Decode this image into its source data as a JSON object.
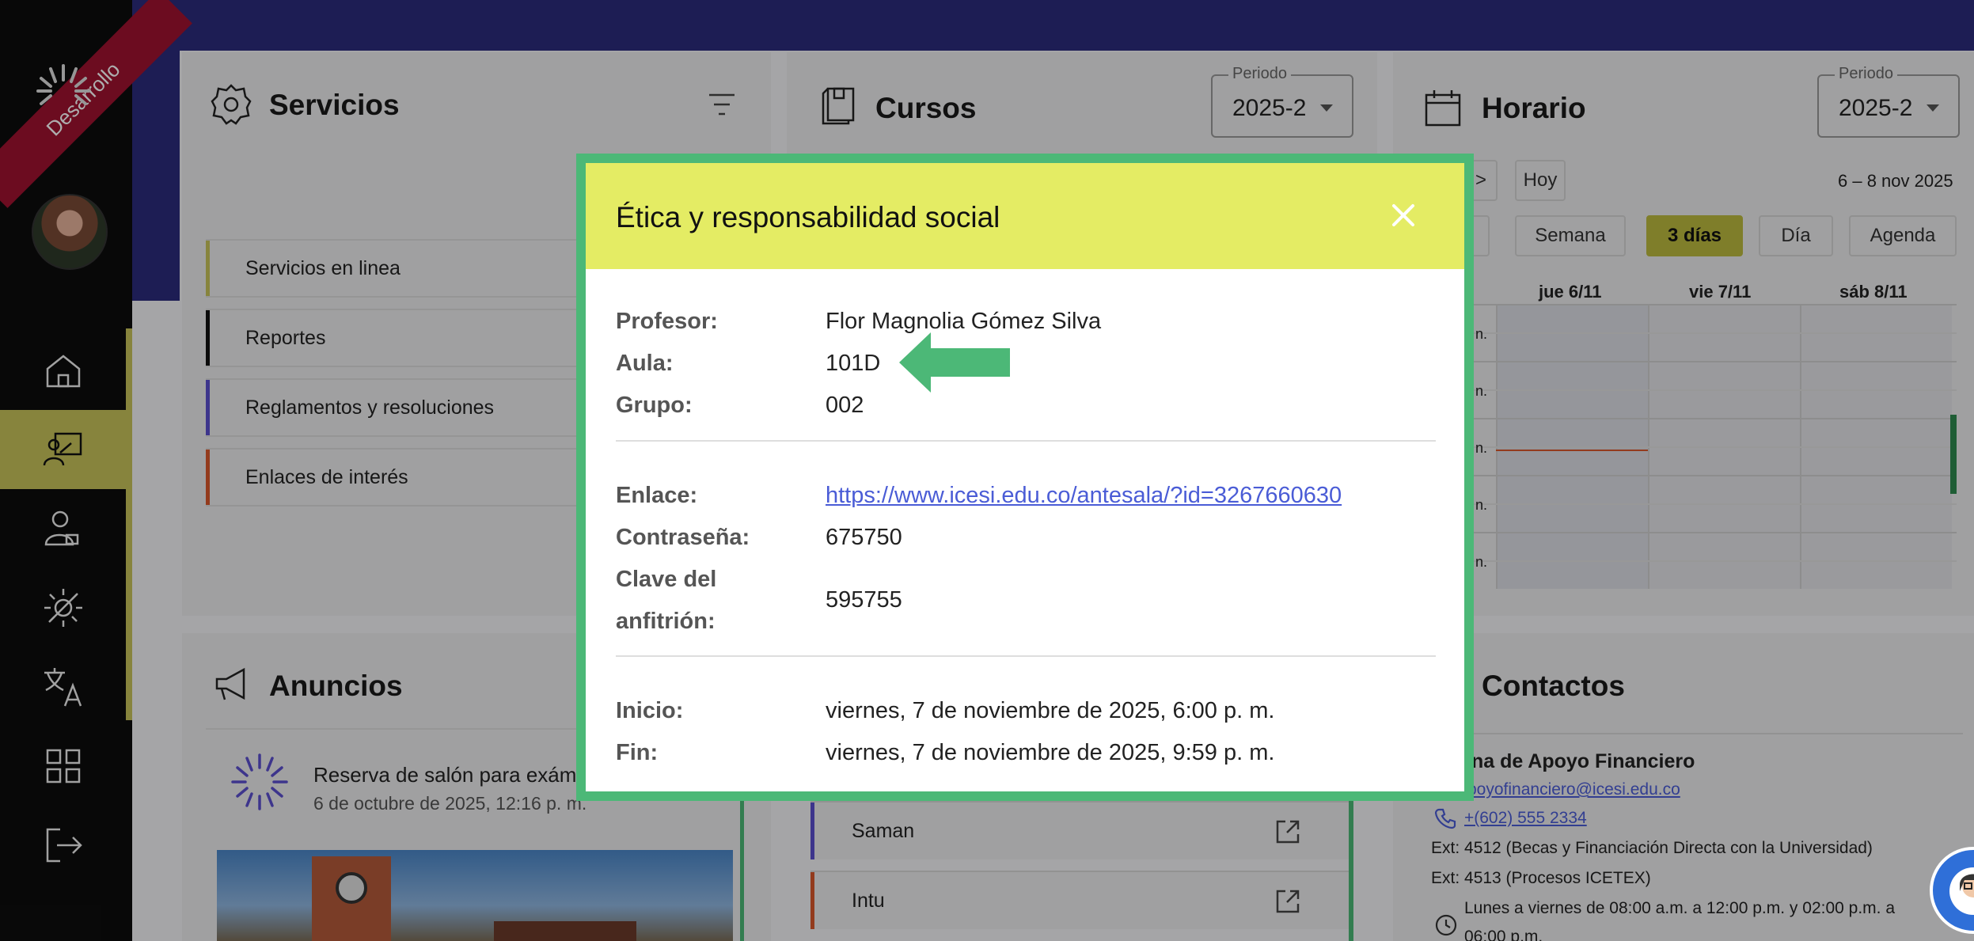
{
  "sidebar": {
    "ribbon_label": "Desarrollo",
    "nav": [
      {
        "icon": "home-icon"
      },
      {
        "icon": "classroom-icon"
      },
      {
        "icon": "user-lock-icon"
      },
      {
        "icon": "brightness-icon"
      },
      {
        "icon": "translate-icon"
      },
      {
        "icon": "grid-icon"
      },
      {
        "icon": "logout-icon"
      }
    ],
    "accent_color": "#c7c35a"
  },
  "servicios": {
    "title": "Servicios",
    "items": [
      {
        "label": "Servicios en linea",
        "color": "#c7c35a"
      },
      {
        "label": "Reportes",
        "color": "#111111"
      },
      {
        "label": "Reglamentos y resoluciones",
        "color": "#5b4fcf"
      },
      {
        "label": "Enlaces de interés",
        "color": "#d9572b"
      }
    ]
  },
  "cursos": {
    "title": "Cursos",
    "periodo_label": "Periodo",
    "periodo_value": "2025-2",
    "links": [
      {
        "label": "Saman",
        "color": "#5b4fcf"
      },
      {
        "label": "Intu",
        "color": "#d9572b"
      }
    ]
  },
  "horario": {
    "title": "Horario",
    "periodo_label": "Periodo",
    "periodo_value": "2025-2",
    "next_label": ">",
    "today_label": "Hoy",
    "range": "6 – 8 nov 2025",
    "views": [
      "Semana",
      "3 días",
      "Día",
      "Agenda"
    ],
    "active_view": "3 días",
    "columns": [
      "jue 6/11",
      "vie 7/11",
      "sáb 8/11"
    ],
    "row_labels": [
      "n.",
      "n.",
      "n.",
      "n.",
      "n."
    ]
  },
  "anuncios": {
    "title": "Anuncios",
    "item_title": "Reserva de salón para exám",
    "item_date": "6 de octubre de 2025, 12:16 p. m."
  },
  "contactos": {
    "title": "Contactos",
    "office": "ina de Apoyo Financiero",
    "email": "poyofinanciero@icesi.edu.co",
    "phone": "+(602) 555 2334",
    "ext1": "Ext: 4512 (Becas y Financiación Directa con la Universidad)",
    "ext2": "Ext: 4513 (Procesos ICETEX)",
    "hours_line1": "Lunes a viernes de 08:00 a.m. a 12:00 p.m. y 02:00 p.m. a",
    "hours_line2": "06:00 p.m."
  },
  "modal": {
    "title": "Ética y responsabilidad social",
    "fields": {
      "profesor_label": "Profesor:",
      "profesor_value": "Flor Magnolia Gómez Silva",
      "aula_label": "Aula:",
      "aula_value": "101D",
      "grupo_label": "Grupo:",
      "grupo_value": "002",
      "enlace_label": "Enlace:",
      "enlace_value": "https://www.icesi.edu.co/antesala/?id=3267660630",
      "contrasena_label": "Contraseña:",
      "contrasena_value": "675750",
      "clave_label_1": "Clave del",
      "clave_label_2": "anfitrión:",
      "clave_value": "595755",
      "inicio_label": "Inicio:",
      "inicio_value": "viernes, 7 de noviembre de 2025, 6:00 p. m.",
      "fin_label": "Fin:",
      "fin_value": "viernes, 7 de noviembre de 2025, 9:59 p. m."
    },
    "border_color": "#4cb877",
    "header_color": "#e4ec64"
  }
}
